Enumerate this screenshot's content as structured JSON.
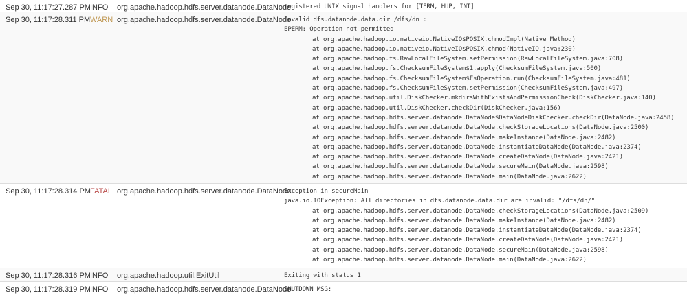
{
  "rows": [
    {
      "timestamp": "Sep 30, 11:17:27.287 PM",
      "level": "INFO",
      "source": "org.apache.hadoop.hdfs.server.datanode.DataNode",
      "message": "registered UNIX signal handlers for [TERM, HUP, INT]"
    },
    {
      "timestamp": "Sep 30, 11:17:28.311 PM",
      "level": "WARN",
      "source": "org.apache.hadoop.hdfs.server.datanode.DataNode",
      "message": "Invalid dfs.datanode.data.dir /dfs/dn :\nEPERM: Operation not permitted\n\tat org.apache.hadoop.io.nativeio.NativeIO$POSIX.chmodImpl(Native Method)\n\tat org.apache.hadoop.io.nativeio.NativeIO$POSIX.chmod(NativeIO.java:230)\n\tat org.apache.hadoop.fs.RawLocalFileSystem.setPermission(RawLocalFileSystem.java:708)\n\tat org.apache.hadoop.fs.ChecksumFileSystem$1.apply(ChecksumFileSystem.java:500)\n\tat org.apache.hadoop.fs.ChecksumFileSystem$FsOperation.run(ChecksumFileSystem.java:481)\n\tat org.apache.hadoop.fs.ChecksumFileSystem.setPermission(ChecksumFileSystem.java:497)\n\tat org.apache.hadoop.util.DiskChecker.mkdirsWithExistsAndPermissionCheck(DiskChecker.java:140)\n\tat org.apache.hadoop.util.DiskChecker.checkDir(DiskChecker.java:156)\n\tat org.apache.hadoop.hdfs.server.datanode.DataNode$DataNodeDiskChecker.checkDir(DataNode.java:2458)\n\tat org.apache.hadoop.hdfs.server.datanode.DataNode.checkStorageLocations(DataNode.java:2500)\n\tat org.apache.hadoop.hdfs.server.datanode.DataNode.makeInstance(DataNode.java:2482)\n\tat org.apache.hadoop.hdfs.server.datanode.DataNode.instantiateDataNode(DataNode.java:2374)\n\tat org.apache.hadoop.hdfs.server.datanode.DataNode.createDataNode(DataNode.java:2421)\n\tat org.apache.hadoop.hdfs.server.datanode.DataNode.secureMain(DataNode.java:2598)\n\tat org.apache.hadoop.hdfs.server.datanode.DataNode.main(DataNode.java:2622)"
    },
    {
      "timestamp": "Sep 30, 11:17:28.314 PM",
      "level": "FATAL",
      "source": "org.apache.hadoop.hdfs.server.datanode.DataNode",
      "message": "Exception in secureMain\njava.io.IOException: All directories in dfs.datanode.data.dir are invalid: \"/dfs/dn/\"\n\tat org.apache.hadoop.hdfs.server.datanode.DataNode.checkStorageLocations(DataNode.java:2509)\n\tat org.apache.hadoop.hdfs.server.datanode.DataNode.makeInstance(DataNode.java:2482)\n\tat org.apache.hadoop.hdfs.server.datanode.DataNode.instantiateDataNode(DataNode.java:2374)\n\tat org.apache.hadoop.hdfs.server.datanode.DataNode.createDataNode(DataNode.java:2421)\n\tat org.apache.hadoop.hdfs.server.datanode.DataNode.secureMain(DataNode.java:2598)\n\tat org.apache.hadoop.hdfs.server.datanode.DataNode.main(DataNode.java:2622)"
    },
    {
      "timestamp": "Sep 30, 11:17:28.316 PM",
      "level": "INFO",
      "source": "org.apache.hadoop.util.ExitUtil",
      "message": "Exiting with status 1"
    },
    {
      "timestamp": "Sep 30, 11:17:28.319 PM",
      "level": "INFO",
      "source": "org.apache.hadoop.hdfs.server.datanode.DataNode",
      "message": "SHUTDOWN_MSG:"
    }
  ],
  "colors": {
    "warn": "#c09853",
    "fatal": "#b94a48",
    "text": "#333333",
    "border": "#dddddd"
  }
}
